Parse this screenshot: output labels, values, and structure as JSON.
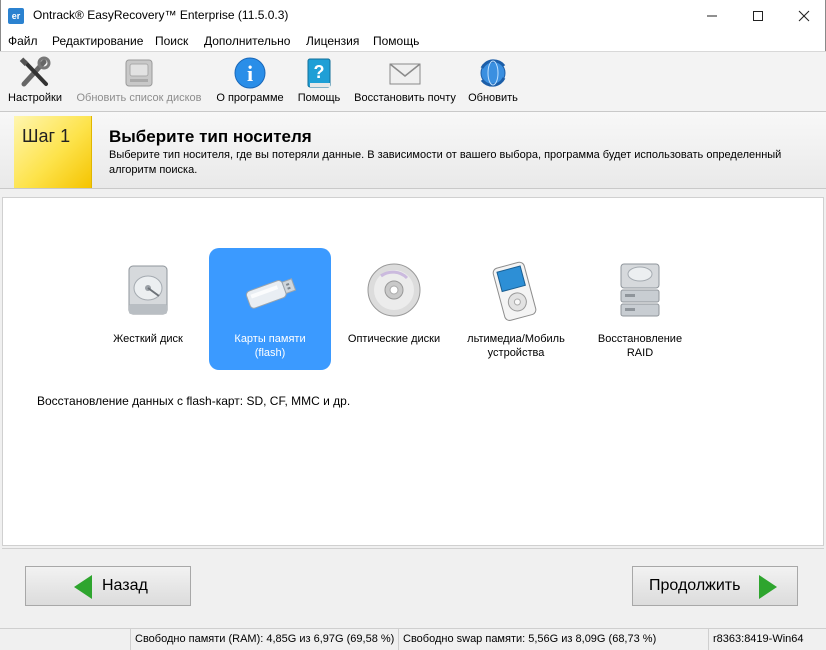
{
  "window": {
    "icon_text": "er",
    "title": "Ontrack® EasyRecovery™ Enterprise (11.5.0.3)"
  },
  "menu": [
    "Файл",
    "Редактирование",
    "Поиск",
    "Дополнительно",
    "Лицензия",
    "Помощь"
  ],
  "toolbar": {
    "settings": "Настройки",
    "refresh_disks": "Обновить список дисков",
    "about": "О программе",
    "help": "Помощь",
    "restore_mail": "Восстановить почту",
    "update": "Обновить"
  },
  "step": {
    "badge": "Шаг 1",
    "title": "Выберите тип носителя",
    "description": "Выберите тип носителя, где вы потеряли данные. В зависимости от вашего выбора, программа будет использовать определенный алгоритм поиска."
  },
  "media": {
    "hdd": "Жесткий диск",
    "flash": "Карты памяти (flash)",
    "optical": "Оптические диски",
    "mobile": "льтимедиа/Мобиль устройства",
    "raid": "Восстановление RAID",
    "selected": "flash",
    "description": "Восстановление данных с flash-карт: SD, CF, MMC и др."
  },
  "nav": {
    "back": "Назад",
    "next": "Продолжить"
  },
  "status": {
    "ram": "Свободно памяти (RAM): 4,85G из 6,97G (69,58 %)",
    "swap": "Свободно swap памяти: 5,56G из 8,09G (68,73 %)",
    "build": "r8363:8419-Win64"
  },
  "colors": {
    "selected_tile": "#3b9aff",
    "step_badge": "#fde34b",
    "arrow": "#2ea52e"
  }
}
